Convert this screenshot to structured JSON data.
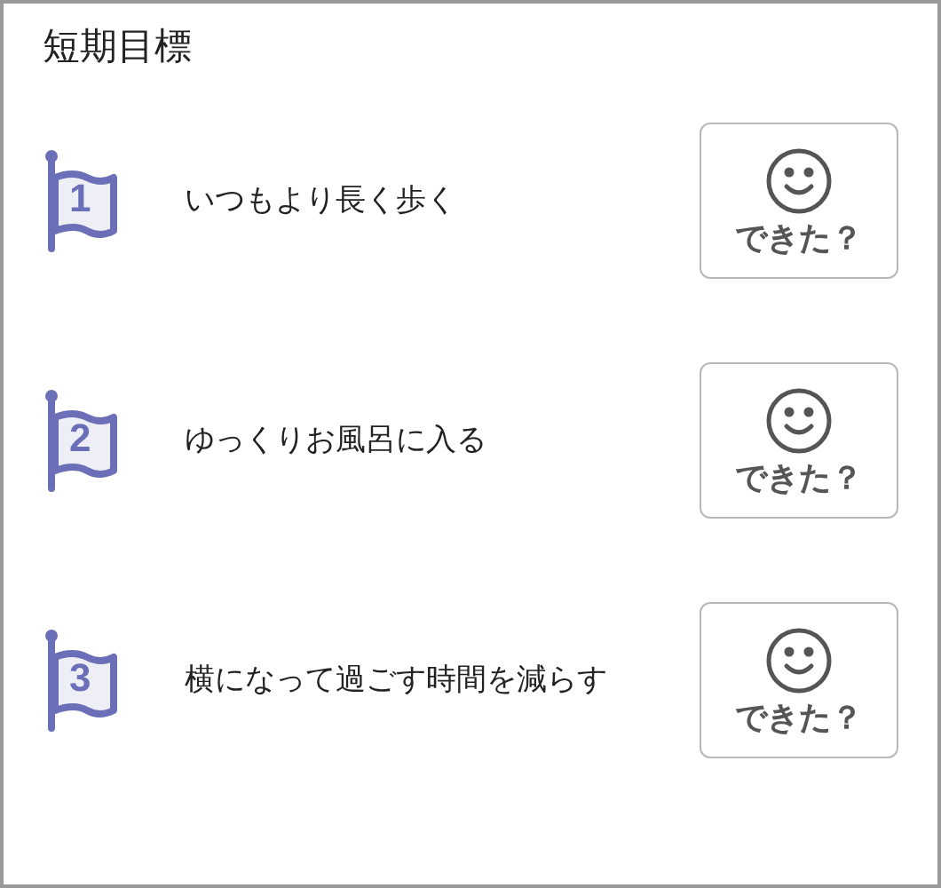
{
  "title": "短期目標",
  "goals": [
    {
      "number": "1",
      "text": "いつもより長く歩く",
      "button": "できた？"
    },
    {
      "number": "2",
      "text": "ゆっくりお風呂に入る",
      "button": "できた？"
    },
    {
      "number": "3",
      "text": "横になって過ごす時間を減らす",
      "button": "できた？"
    }
  ]
}
